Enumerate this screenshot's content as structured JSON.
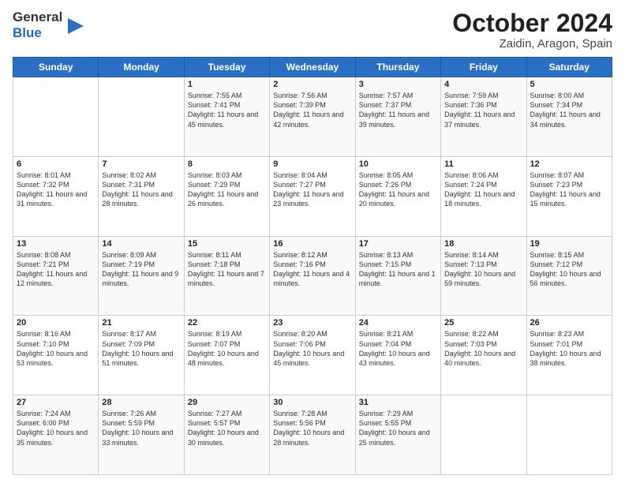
{
  "header": {
    "logo_general": "General",
    "logo_blue": "Blue",
    "title": "October 2024",
    "subtitle": "Zaidin, Aragon, Spain"
  },
  "weekdays": [
    "Sunday",
    "Monday",
    "Tuesday",
    "Wednesday",
    "Thursday",
    "Friday",
    "Saturday"
  ],
  "weeks": [
    [
      {
        "day": "",
        "sunrise": "",
        "sunset": "",
        "daylight": ""
      },
      {
        "day": "",
        "sunrise": "",
        "sunset": "",
        "daylight": ""
      },
      {
        "day": "1",
        "sunrise": "Sunrise: 7:55 AM",
        "sunset": "Sunset: 7:41 PM",
        "daylight": "Daylight: 11 hours and 45 minutes."
      },
      {
        "day": "2",
        "sunrise": "Sunrise: 7:56 AM",
        "sunset": "Sunset: 7:39 PM",
        "daylight": "Daylight: 11 hours and 42 minutes."
      },
      {
        "day": "3",
        "sunrise": "Sunrise: 7:57 AM",
        "sunset": "Sunset: 7:37 PM",
        "daylight": "Daylight: 11 hours and 39 minutes."
      },
      {
        "day": "4",
        "sunrise": "Sunrise: 7:59 AM",
        "sunset": "Sunset: 7:36 PM",
        "daylight": "Daylight: 11 hours and 37 minutes."
      },
      {
        "day": "5",
        "sunrise": "Sunrise: 8:00 AM",
        "sunset": "Sunset: 7:34 PM",
        "daylight": "Daylight: 11 hours and 34 minutes."
      }
    ],
    [
      {
        "day": "6",
        "sunrise": "Sunrise: 8:01 AM",
        "sunset": "Sunset: 7:32 PM",
        "daylight": "Daylight: 11 hours and 31 minutes."
      },
      {
        "day": "7",
        "sunrise": "Sunrise: 8:02 AM",
        "sunset": "Sunset: 7:31 PM",
        "daylight": "Daylight: 11 hours and 28 minutes."
      },
      {
        "day": "8",
        "sunrise": "Sunrise: 8:03 AM",
        "sunset": "Sunset: 7:29 PM",
        "daylight": "Daylight: 11 hours and 26 minutes."
      },
      {
        "day": "9",
        "sunrise": "Sunrise: 8:04 AM",
        "sunset": "Sunset: 7:27 PM",
        "daylight": "Daylight: 11 hours and 23 minutes."
      },
      {
        "day": "10",
        "sunrise": "Sunrise: 8:05 AM",
        "sunset": "Sunset: 7:26 PM",
        "daylight": "Daylight: 11 hours and 20 minutes."
      },
      {
        "day": "11",
        "sunrise": "Sunrise: 8:06 AM",
        "sunset": "Sunset: 7:24 PM",
        "daylight": "Daylight: 11 hours and 18 minutes."
      },
      {
        "day": "12",
        "sunrise": "Sunrise: 8:07 AM",
        "sunset": "Sunset: 7:23 PM",
        "daylight": "Daylight: 11 hours and 15 minutes."
      }
    ],
    [
      {
        "day": "13",
        "sunrise": "Sunrise: 8:08 AM",
        "sunset": "Sunset: 7:21 PM",
        "daylight": "Daylight: 11 hours and 12 minutes."
      },
      {
        "day": "14",
        "sunrise": "Sunrise: 8:09 AM",
        "sunset": "Sunset: 7:19 PM",
        "daylight": "Daylight: 11 hours and 9 minutes."
      },
      {
        "day": "15",
        "sunrise": "Sunrise: 8:11 AM",
        "sunset": "Sunset: 7:18 PM",
        "daylight": "Daylight: 11 hours and 7 minutes."
      },
      {
        "day": "16",
        "sunrise": "Sunrise: 8:12 AM",
        "sunset": "Sunset: 7:16 PM",
        "daylight": "Daylight: 11 hours and 4 minutes."
      },
      {
        "day": "17",
        "sunrise": "Sunrise: 8:13 AM",
        "sunset": "Sunset: 7:15 PM",
        "daylight": "Daylight: 11 hours and 1 minute."
      },
      {
        "day": "18",
        "sunrise": "Sunrise: 8:14 AM",
        "sunset": "Sunset: 7:13 PM",
        "daylight": "Daylight: 10 hours and 59 minutes."
      },
      {
        "day": "19",
        "sunrise": "Sunrise: 8:15 AM",
        "sunset": "Sunset: 7:12 PM",
        "daylight": "Daylight: 10 hours and 56 minutes."
      }
    ],
    [
      {
        "day": "20",
        "sunrise": "Sunrise: 8:16 AM",
        "sunset": "Sunset: 7:10 PM",
        "daylight": "Daylight: 10 hours and 53 minutes."
      },
      {
        "day": "21",
        "sunrise": "Sunrise: 8:17 AM",
        "sunset": "Sunset: 7:09 PM",
        "daylight": "Daylight: 10 hours and 51 minutes."
      },
      {
        "day": "22",
        "sunrise": "Sunrise: 8:19 AM",
        "sunset": "Sunset: 7:07 PM",
        "daylight": "Daylight: 10 hours and 48 minutes."
      },
      {
        "day": "23",
        "sunrise": "Sunrise: 8:20 AM",
        "sunset": "Sunset: 7:06 PM",
        "daylight": "Daylight: 10 hours and 45 minutes."
      },
      {
        "day": "24",
        "sunrise": "Sunrise: 8:21 AM",
        "sunset": "Sunset: 7:04 PM",
        "daylight": "Daylight: 10 hours and 43 minutes."
      },
      {
        "day": "25",
        "sunrise": "Sunrise: 8:22 AM",
        "sunset": "Sunset: 7:03 PM",
        "daylight": "Daylight: 10 hours and 40 minutes."
      },
      {
        "day": "26",
        "sunrise": "Sunrise: 8:23 AM",
        "sunset": "Sunset: 7:01 PM",
        "daylight": "Daylight: 10 hours and 38 minutes."
      }
    ],
    [
      {
        "day": "27",
        "sunrise": "Sunrise: 7:24 AM",
        "sunset": "Sunset: 6:00 PM",
        "daylight": "Daylight: 10 hours and 35 minutes."
      },
      {
        "day": "28",
        "sunrise": "Sunrise: 7:26 AM",
        "sunset": "Sunset: 5:59 PM",
        "daylight": "Daylight: 10 hours and 33 minutes."
      },
      {
        "day": "29",
        "sunrise": "Sunrise: 7:27 AM",
        "sunset": "Sunset: 5:57 PM",
        "daylight": "Daylight: 10 hours and 30 minutes."
      },
      {
        "day": "30",
        "sunrise": "Sunrise: 7:28 AM",
        "sunset": "Sunset: 5:56 PM",
        "daylight": "Daylight: 10 hours and 28 minutes."
      },
      {
        "day": "31",
        "sunrise": "Sunrise: 7:29 AM",
        "sunset": "Sunset: 5:55 PM",
        "daylight": "Daylight: 10 hours and 25 minutes."
      },
      {
        "day": "",
        "sunrise": "",
        "sunset": "",
        "daylight": ""
      },
      {
        "day": "",
        "sunrise": "",
        "sunset": "",
        "daylight": ""
      }
    ]
  ]
}
